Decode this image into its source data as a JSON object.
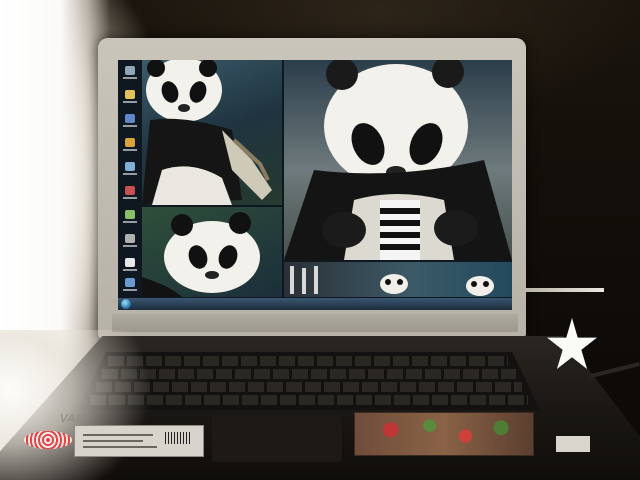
{
  "laptop": {
    "brand_text": "",
    "deck_logo": "VAIO",
    "wallpaper_subject": ""
  },
  "desktop": {
    "icon_count": 10,
    "icon_names": [
      "recycle-bin-icon",
      "folder-icon",
      "app-icon",
      "app-icon",
      "network-icon",
      "app-icon",
      "app-icon",
      "app-icon",
      "document-icon",
      "app-icon"
    ]
  },
  "colors": {
    "room": "#120e09",
    "lid": "#c9c5bb",
    "taskbar": "#1c2c3c",
    "panda_white": "#f2f1ec",
    "panda_black": "#111111"
  }
}
